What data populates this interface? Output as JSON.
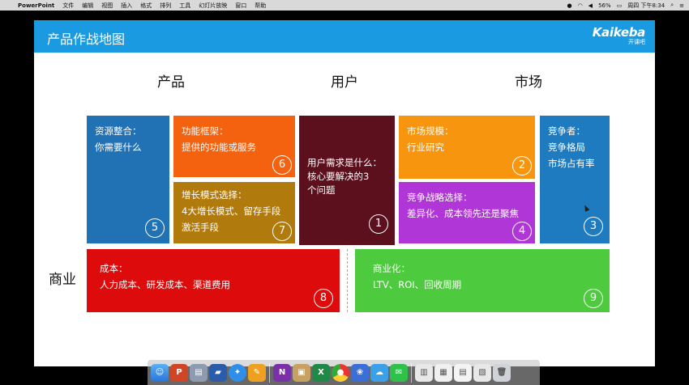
{
  "menubar": {
    "app_name": "PowerPoint",
    "menus": [
      "文件",
      "编辑",
      "视图",
      "插入",
      "格式",
      "排列",
      "工具",
      "幻灯片放映",
      "窗口",
      "帮助"
    ],
    "battery": "56%",
    "clock": "周四 下午8:34"
  },
  "slide": {
    "title": "产品作战地图",
    "logo_text": "Kaikeba",
    "logo_sub": "开课吧",
    "column_headers": {
      "product": "产品",
      "user": "用户",
      "market": "市场"
    },
    "row_header": "商业",
    "cards": {
      "c5": {
        "line1": "资源整合：",
        "line2": "你需要什么",
        "num": "5"
      },
      "c6": {
        "line1": "功能框架：",
        "line2": "提供的功能或服务",
        "num": "6"
      },
      "c7": {
        "line1": "增长模式选择：",
        "line2": "4大增长模式、留存手段",
        "line3": "激活手段",
        "num": "7"
      },
      "c1": {
        "line1": "用户需求是什么：",
        "line2": "核心要解决的3",
        "line3": "个问题",
        "num": "1"
      },
      "c2": {
        "line1": "市场规模：",
        "line2": "行业研究",
        "num": "2"
      },
      "c4": {
        "line1": "竞争战略选择：",
        "line2": "差异化、成本领先还是聚焦",
        "num": "4"
      },
      "c3": {
        "line1": "竞争者：",
        "line2": "竞争格局",
        "line3": "市场占有率",
        "num": "3"
      },
      "c8": {
        "line1": "成本：",
        "line2": "人力成本、研发成本、渠道费用",
        "num": "8"
      },
      "c9": {
        "line1": "商业化：",
        "line2": "LTV、ROI、回收周期",
        "num": "9"
      }
    },
    "colors": {
      "header": "#1a9ae0",
      "c5": "#2171b5",
      "c6": "#f5620f",
      "c7": "#b07a0c",
      "c1": "#5c0f1c",
      "c2": "#f7950f",
      "c4": "#b136d7",
      "c3": "#1e7bbf",
      "c8": "#dd0b0b",
      "c9": "#4dca3d"
    }
  },
  "dock": {
    "icons": [
      "finder-icon",
      "powerpoint-icon",
      "preview-icon",
      "keynote-icon",
      "safari-icon",
      "pages-icon",
      "onenote-icon",
      "office-icon",
      "excel-icon",
      "chrome-icon",
      "app-icon",
      "cloud-icon",
      "wechat-icon",
      "document-icon",
      "document-icon",
      "document-icon",
      "document-icon",
      "trash-icon"
    ]
  }
}
